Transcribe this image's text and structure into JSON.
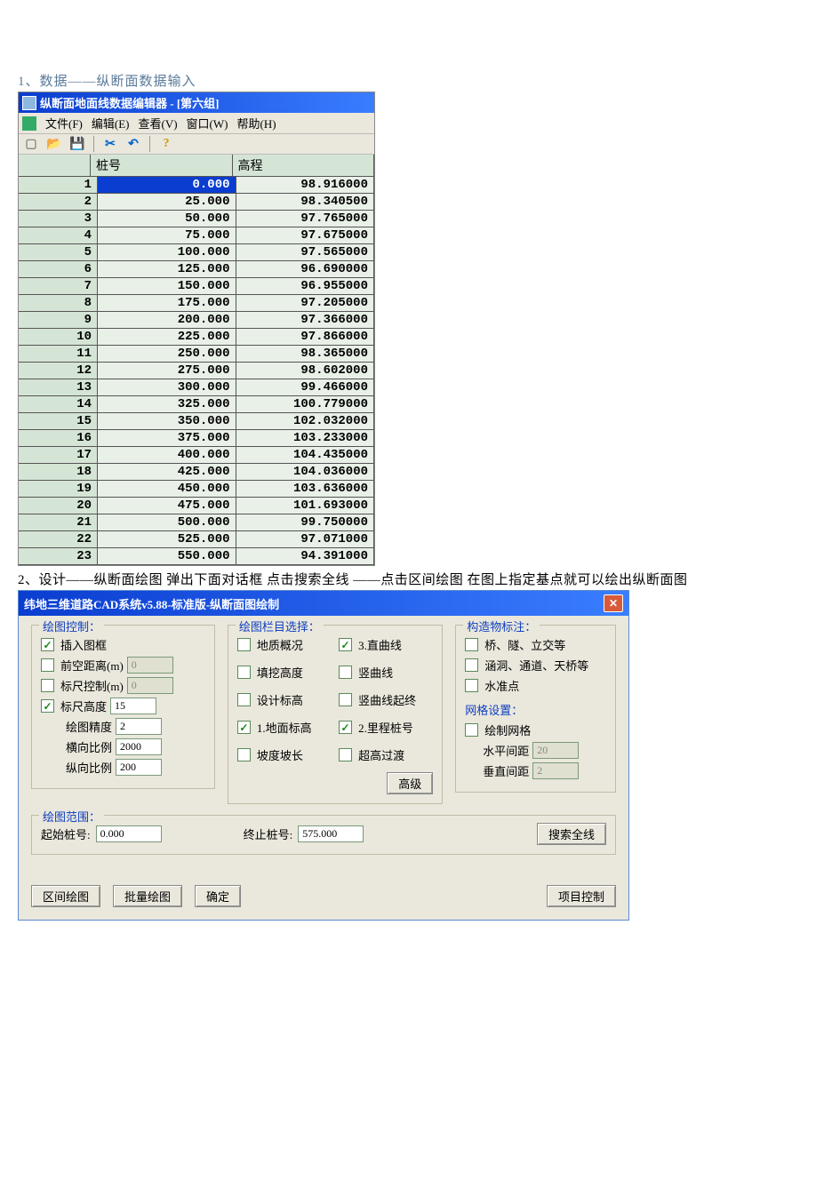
{
  "caption1": "1、数据——纵断面数据输入",
  "editor": {
    "title": "纵断面地面线数据编辑器 - [第六组]",
    "menus": {
      "file": "文件(F)",
      "edit": "编辑(E)",
      "view": "查看(V)",
      "window": "窗口(W)",
      "help": "帮助(H)"
    },
    "toolbar": {
      "new": "新建",
      "open": "打开",
      "save": "保存",
      "cut": "剪切",
      "undo": "撤销",
      "help": "帮助"
    },
    "columns": {
      "stake": "桩号",
      "elev": "高程"
    },
    "rows": [
      {
        "n": "1",
        "stake": "0.000",
        "elev": "98.916000"
      },
      {
        "n": "2",
        "stake": "25.000",
        "elev": "98.340500"
      },
      {
        "n": "3",
        "stake": "50.000",
        "elev": "97.765000"
      },
      {
        "n": "4",
        "stake": "75.000",
        "elev": "97.675000"
      },
      {
        "n": "5",
        "stake": "100.000",
        "elev": "97.565000"
      },
      {
        "n": "6",
        "stake": "125.000",
        "elev": "96.690000"
      },
      {
        "n": "7",
        "stake": "150.000",
        "elev": "96.955000"
      },
      {
        "n": "8",
        "stake": "175.000",
        "elev": "97.205000"
      },
      {
        "n": "9",
        "stake": "200.000",
        "elev": "97.366000"
      },
      {
        "n": "10",
        "stake": "225.000",
        "elev": "97.866000"
      },
      {
        "n": "11",
        "stake": "250.000",
        "elev": "98.365000"
      },
      {
        "n": "12",
        "stake": "275.000",
        "elev": "98.602000"
      },
      {
        "n": "13",
        "stake": "300.000",
        "elev": "99.466000"
      },
      {
        "n": "14",
        "stake": "325.000",
        "elev": "100.779000"
      },
      {
        "n": "15",
        "stake": "350.000",
        "elev": "102.032000"
      },
      {
        "n": "16",
        "stake": "375.000",
        "elev": "103.233000"
      },
      {
        "n": "17",
        "stake": "400.000",
        "elev": "104.435000"
      },
      {
        "n": "18",
        "stake": "425.000",
        "elev": "104.036000"
      },
      {
        "n": "19",
        "stake": "450.000",
        "elev": "103.636000"
      },
      {
        "n": "20",
        "stake": "475.000",
        "elev": "101.693000"
      },
      {
        "n": "21",
        "stake": "500.000",
        "elev": "99.750000"
      },
      {
        "n": "22",
        "stake": "525.000",
        "elev": "97.071000"
      },
      {
        "n": "23",
        "stake": "550.000",
        "elev": "94.391000"
      }
    ]
  },
  "caption2": "2、设计——纵断面绘图  弹出下面对话框  点击搜索全线  ——点击区间绘图   在图上指定基点就可以绘出纵断面图",
  "dialog": {
    "title": "纬地三维道路CAD系统v5.88-标准版-纵断面图绘制",
    "groups": {
      "g1": {
        "title": "绘图控制：",
        "insert_frame": "插入图框",
        "front_space": "前空距离(m)",
        "ruler_ctrl": "标尺控制(m)",
        "ruler_height": "标尺高度",
        "precision": "绘图精度",
        "hscale": "横向比例",
        "vscale": "纵向比例",
        "front_space_val": "0",
        "ruler_ctrl_val": "0",
        "ruler_height_val": "15",
        "precision_val": "2",
        "hscale_val": "2000",
        "vscale_val": "200"
      },
      "g2": {
        "title": "绘图栏目选择：",
        "geo": "地质概况",
        "curve3": "3.直曲线",
        "fill": "填挖高度",
        "vcurve": "竖曲线",
        "design": "设计标高",
        "vcurve_se": "竖曲线起终",
        "ground1": "1.地面标高",
        "mile2": "2.里程桩号",
        "slope": "坡度坡长",
        "super": "超高过渡",
        "advanced": "高级"
      },
      "g3": {
        "title": "构造物标注：",
        "bridge": "桥、隧、立交等",
        "culvert": "涵洞、通道、天桥等",
        "bm": "水准点",
        "grid_title": "网格设置：",
        "draw_grid": "绘制网格",
        "hspace": "水平间距",
        "vspace": "垂直间距",
        "hspace_val": "20",
        "vspace_val": "2"
      },
      "range": {
        "title": "绘图范围：",
        "start": "起始桩号:",
        "end": "终止桩号:",
        "start_val": "0.000",
        "end_val": "575.000",
        "search": "搜索全线"
      }
    },
    "buttons": {
      "interval": "区间绘图",
      "batch": "批量绘图",
      "ok": "确定",
      "project": "项目控制"
    }
  }
}
